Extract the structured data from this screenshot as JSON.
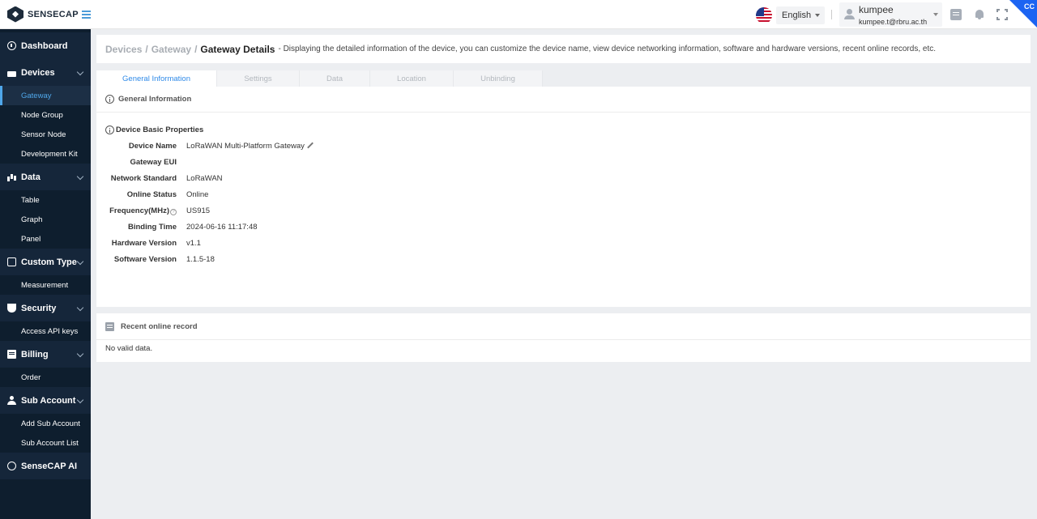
{
  "header": {
    "logo_text": "SENSECAP",
    "language": "English",
    "user_name": "kumpee",
    "user_email": "kumpee.t@rbru.ac.th",
    "corner_badge": "CC"
  },
  "sidebar": {
    "groups": [
      {
        "label": "Dashboard",
        "icon": "dashboard-icon",
        "items": []
      },
      {
        "label": "Devices",
        "icon": "devices-icon",
        "items": [
          "Gateway",
          "Node Group",
          "Sensor Node",
          "Development Kit"
        ]
      },
      {
        "label": "Data",
        "icon": "data-icon",
        "items": [
          "Table",
          "Graph",
          "Panel"
        ]
      },
      {
        "label": "Custom Type",
        "icon": "custom-type-icon",
        "items": [
          "Measurement"
        ]
      },
      {
        "label": "Security",
        "icon": "shield-icon",
        "items": [
          "Access API keys"
        ]
      },
      {
        "label": "Billing",
        "icon": "billing-icon",
        "items": [
          "Order"
        ]
      },
      {
        "label": "Sub Account",
        "icon": "user-icon",
        "items": [
          "Add Sub Account",
          "Sub Account List"
        ]
      },
      {
        "label": "SenseCAP AI",
        "icon": "chat-icon",
        "items": []
      }
    ],
    "active_item": "Gateway"
  },
  "breadcrumb": {
    "crumb1": "Devices",
    "crumb2": "Gateway",
    "separator": "/",
    "current": "Gateway Details",
    "description": "- Displaying the detailed information of the device, you can customize the device name, view device networking information, software and hardware versions, recent online records, etc."
  },
  "tabs": [
    "General Information",
    "Settings",
    "Data",
    "Location",
    "Unbinding"
  ],
  "general": {
    "section_title": "General Information",
    "props_title": "Device Basic Properties",
    "properties": [
      {
        "label": "Device Name",
        "value": "LoRaWAN Multi-Platform Gateway"
      },
      {
        "label": "Gateway EUI",
        "value": ""
      },
      {
        "label": "Network Standard",
        "value": "LoRaWAN"
      },
      {
        "label": "Online Status",
        "value": "Online"
      },
      {
        "label": "Frequency(MHz)",
        "value": "US915"
      },
      {
        "label": "Binding Time",
        "value": "2024-06-16 11:17:48"
      },
      {
        "label": "Hardware Version",
        "value": "v1.1"
      },
      {
        "label": "Software Version",
        "value": "1.1.5-18"
      }
    ]
  },
  "records": {
    "title": "Recent online record",
    "empty_text": "No valid data."
  },
  "colors": {
    "sidebar_bg": "#0e1e2e",
    "accent": "#2f8ae8",
    "corner": "#1c64f2"
  }
}
